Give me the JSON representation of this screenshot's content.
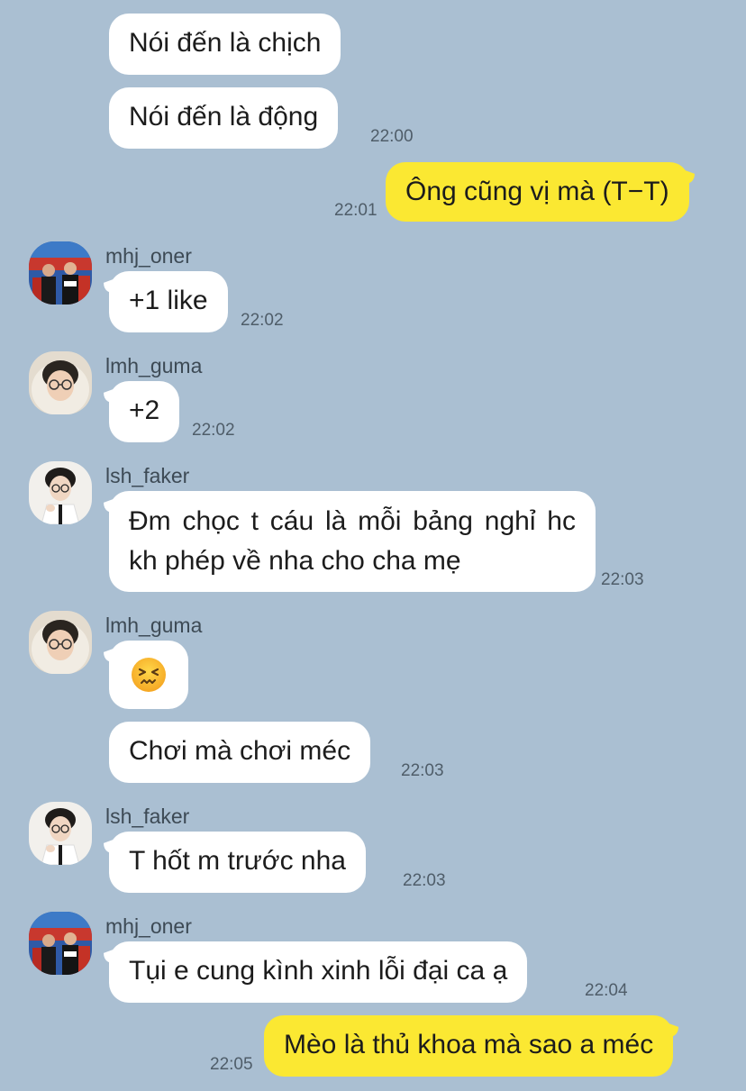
{
  "messages": [
    {
      "text": "Nói đến là chịch"
    },
    {
      "text": "Nói đến là động",
      "time": "22:00"
    },
    {
      "text": "Ông cũng vị mà (T−T)",
      "time": "22:01"
    },
    {
      "sender": "mhj_oner",
      "text": "+1 like",
      "time": "22:02"
    },
    {
      "sender": "lmh_guma",
      "text": "+2",
      "time": "22:02"
    },
    {
      "sender": "lsh_faker",
      "text": "Đm chọc t cáu là mỗi bảng nghỉ hc kh phép về nha cho cha mẹ",
      "time": "22:03"
    },
    {
      "sender": "lmh_guma",
      "emoji": "confounded-face-emoji"
    },
    {
      "text": "Chơi mà chơi méc",
      "time": "22:03"
    },
    {
      "sender": "lsh_faker",
      "text": "T hốt m trước nha",
      "time": "22:03"
    },
    {
      "sender": "mhj_oner",
      "text": "Tụi e cung kình xinh lỗi đại ca ạ",
      "time": "22:04"
    },
    {
      "text": "Mèo là thủ khoa mà sao a méc",
      "time": "22:05"
    }
  ],
  "colors": {
    "background": "#aabfd2",
    "incoming_bubble": "#ffffff",
    "outgoing_bubble": "#fbe832"
  }
}
